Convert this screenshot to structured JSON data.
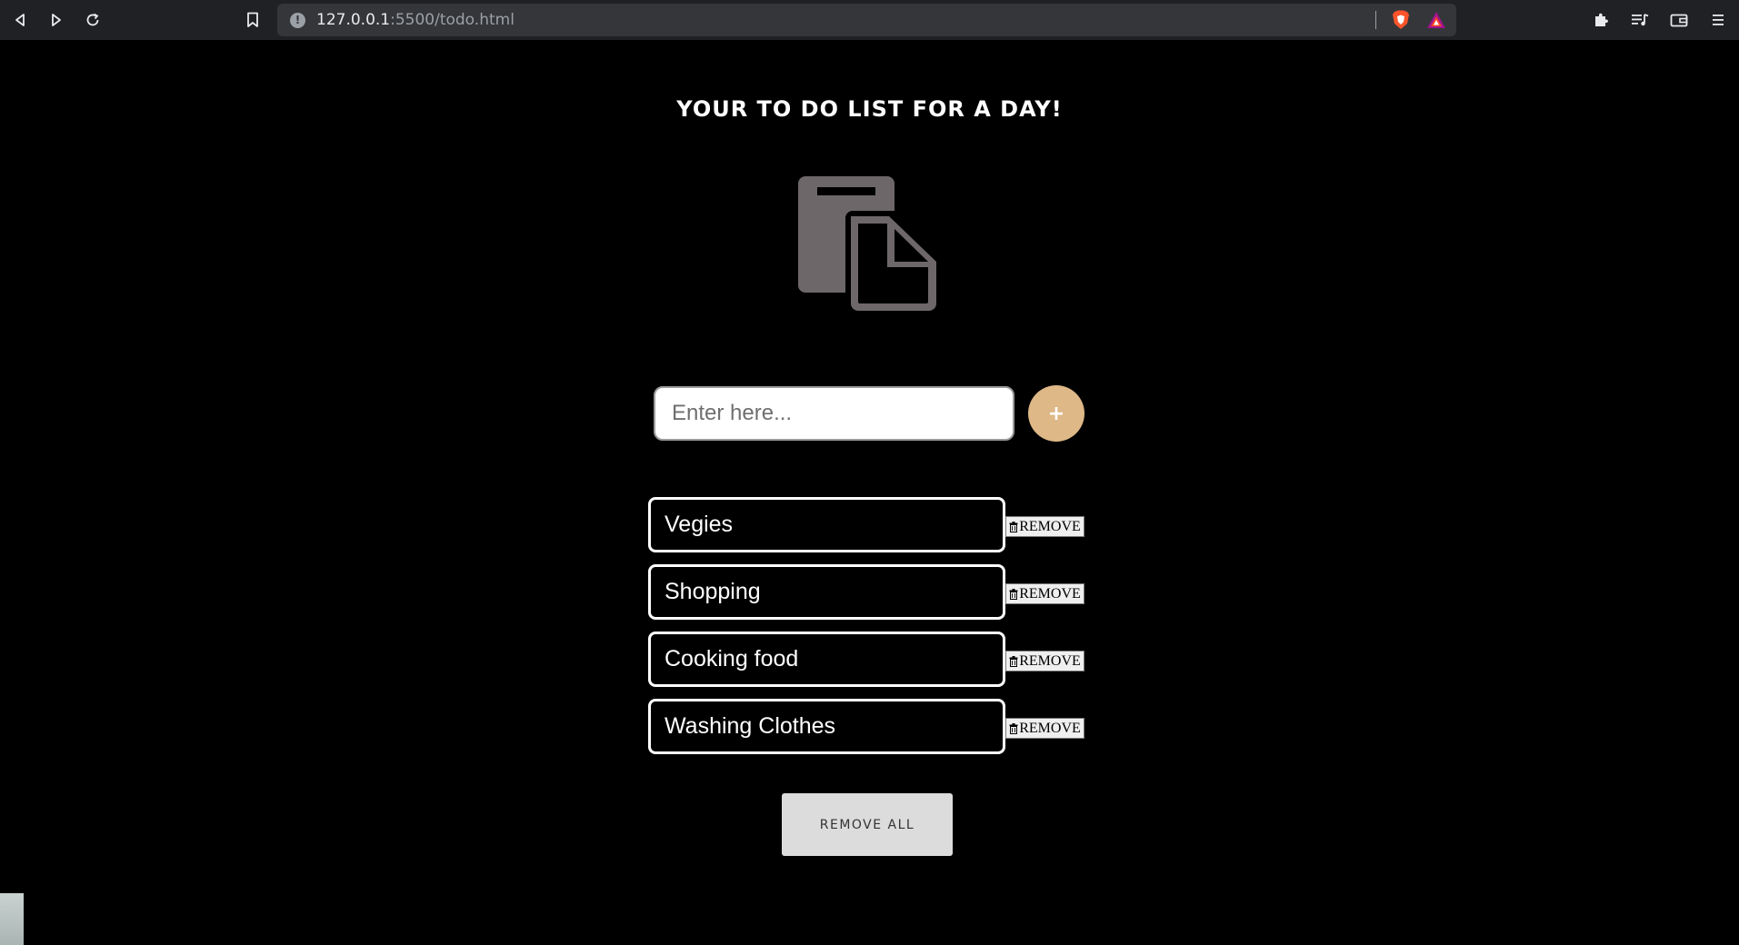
{
  "browser": {
    "url_host": "127.0.0.1",
    "url_path": ":5500/todo.html",
    "back_icon": "back-icon",
    "forward_icon": "forward-icon",
    "reload_icon": "reload-icon",
    "bookmark_icon": "bookmark-icon",
    "info_icon": "info-icon",
    "info_glyph": "!",
    "brave_icon": "brave-shield-icon",
    "rewards_icon": "brave-rewards-icon",
    "extensions_icon": "puzzle-icon",
    "playlist_icon": "playlist-icon",
    "wallet_icon": "wallet-icon",
    "menu_icon": "menu-icon"
  },
  "header": {
    "title": "YOUR TO DO LIST FOR A DAY!"
  },
  "logo": {
    "icon": "clipboard-icon",
    "color": "#6d6769"
  },
  "form": {
    "placeholder": "Enter here...",
    "value": "",
    "add_label": "+",
    "add_color": "#deb887"
  },
  "todos": [
    {
      "text": "Vegies",
      "remove_label": "REMOVE"
    },
    {
      "text": "Shopping",
      "remove_label": "REMOVE"
    },
    {
      "text": "Cooking food",
      "remove_label": "REMOVE"
    },
    {
      "text": "Washing Clothes",
      "remove_label": "REMOVE"
    }
  ],
  "actions": {
    "remove_all_label": "REMOVE ALL"
  }
}
